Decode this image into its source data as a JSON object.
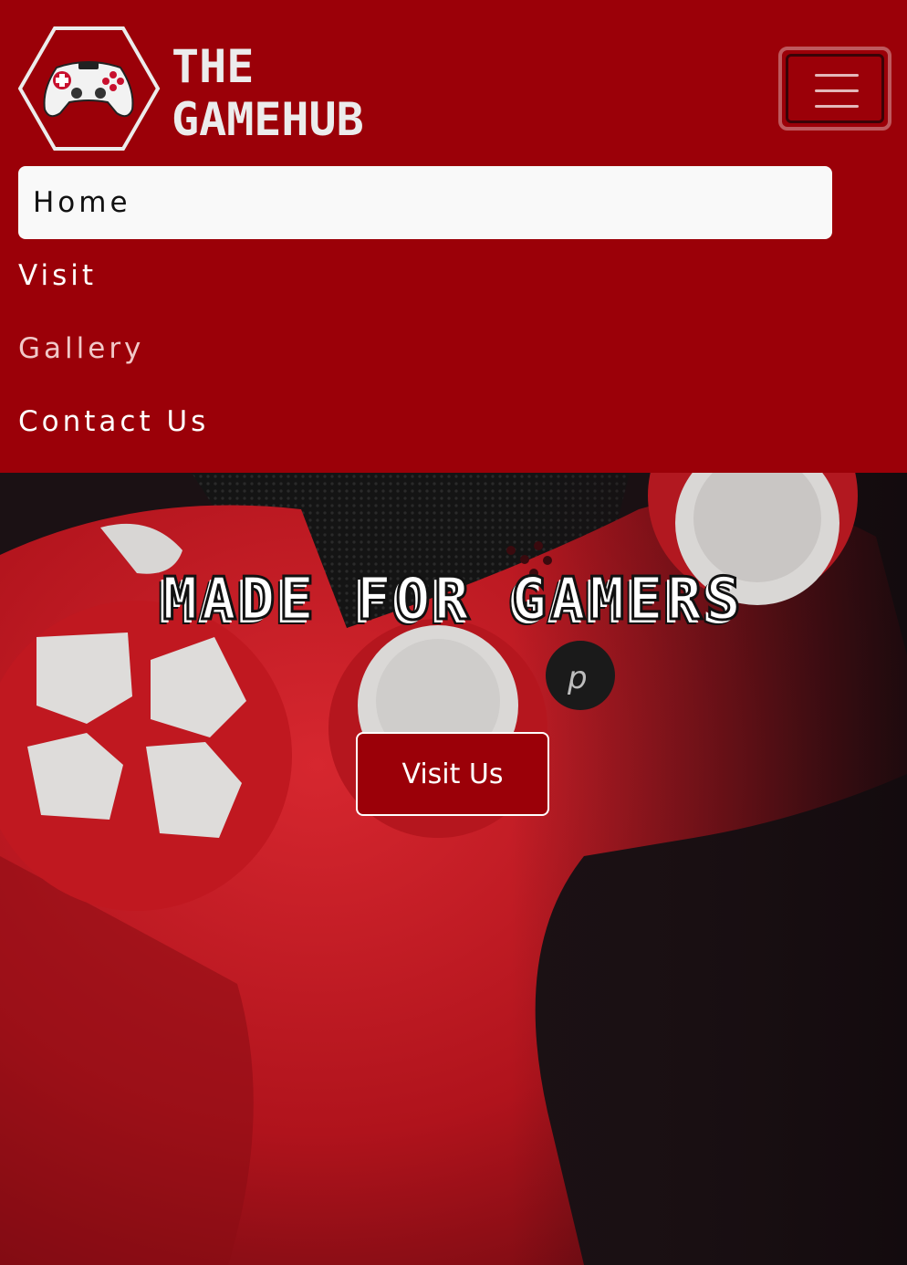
{
  "brand": {
    "logo_line1": "THE",
    "logo_line2": "GAMEHUB",
    "logo_icon": "gamepad-hexagon-icon"
  },
  "nav": {
    "toggler_icon": "hamburger-menu-icon",
    "items": [
      {
        "label": "Home"
      },
      {
        "label": "Visit"
      },
      {
        "label": "Gallery"
      },
      {
        "label": "Contact Us"
      }
    ]
  },
  "hero": {
    "title": "MADE FOR GAMERS",
    "button_label": "Visit Us",
    "background_icon": "red-game-controller-photo"
  },
  "colors": {
    "brand_red": "#9b0008",
    "active_item_bg": "#f9f9f9",
    "text_light": "#ffffff"
  }
}
